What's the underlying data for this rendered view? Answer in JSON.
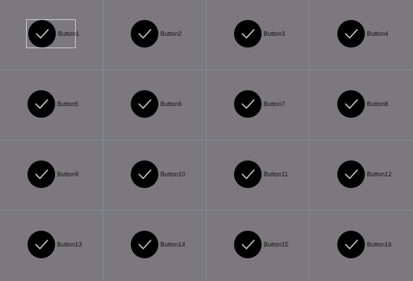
{
  "buttons": [
    {
      "label": "Button1"
    },
    {
      "label": "Button2"
    },
    {
      "label": "Button3"
    },
    {
      "label": "Button4"
    },
    {
      "label": "Button5"
    },
    {
      "label": "Button6"
    },
    {
      "label": "Button7"
    },
    {
      "label": "Button8"
    },
    {
      "label": "Button9"
    },
    {
      "label": "Button10"
    },
    {
      "label": "Button11"
    },
    {
      "label": "Button12"
    },
    {
      "label": "Button13"
    },
    {
      "label": "Button14"
    },
    {
      "label": "Button15"
    },
    {
      "label": "Button16"
    }
  ],
  "icons": {
    "check": "check-icon"
  },
  "colors": {
    "background": "#7b797b",
    "grid_line": "#7f8ea4",
    "icon_bg": "#000000",
    "icon_stroke": "#c8c8c8",
    "focus_border": "#cfd6dc"
  }
}
